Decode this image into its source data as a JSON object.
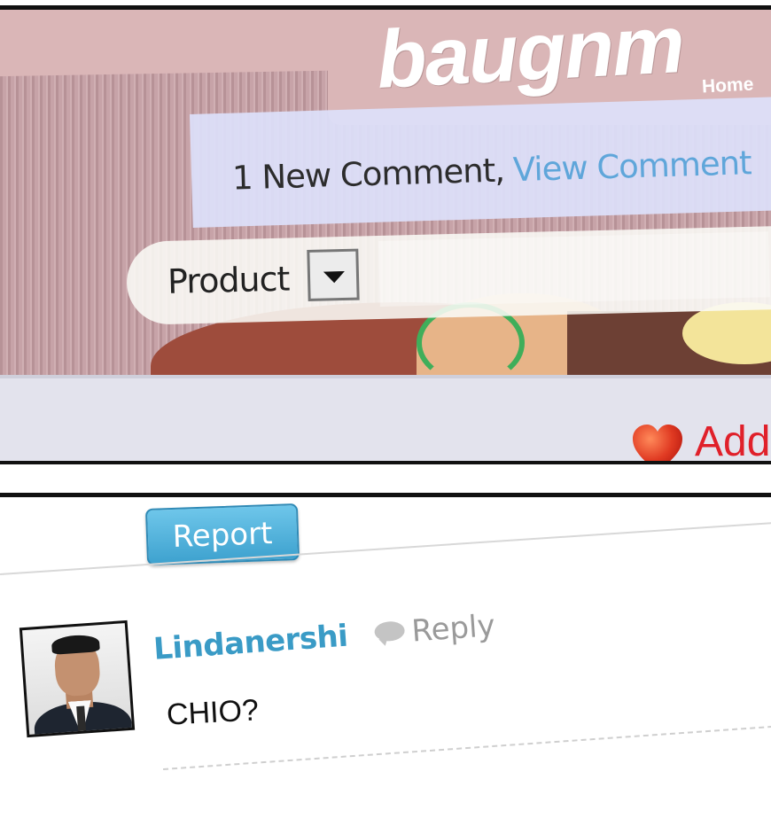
{
  "header": {
    "logo_text": "baugnm",
    "home_link": "Home"
  },
  "notification": {
    "text": "1 New Comment,",
    "link": "View Comment",
    "link_color": "#5fa6da"
  },
  "filter": {
    "selected_value": "Product"
  },
  "favorite": {
    "label": "Add",
    "icon": "heart-icon",
    "color": "#e0202a"
  },
  "report": {
    "label": "Report",
    "color": "#3ea2cf"
  },
  "comment": {
    "username": "Lindanershi",
    "reply_label": "Reply",
    "reply_icon": "speech-bubble-icon",
    "text": "CHIO?"
  }
}
